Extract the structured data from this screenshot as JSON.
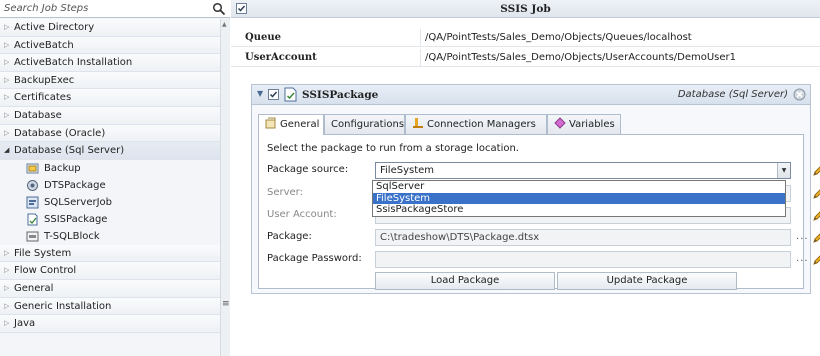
{
  "search": {
    "placeholder": "Search Job Steps",
    "icon": "magnifier-icon"
  },
  "steps": {
    "before": [
      "Active Directory",
      "ActiveBatch",
      "ActiveBatch Installation",
      "BackupExec",
      "Certificates",
      "Database",
      "Database (Oracle)"
    ],
    "open": "Database (Sql Server)",
    "children": [
      "Backup",
      "DTSPackage",
      "SQLServerJob",
      "SSISPackage",
      "T-SQLBlock"
    ],
    "after": [
      "File System",
      "Flow Control",
      "General",
      "Generic Installation",
      "Java"
    ]
  },
  "header": {
    "title": "SSIS Job"
  },
  "properties": [
    {
      "key": "Queue",
      "value": "/QA/PointTests/Sales_Demo/Objects/Queues/localhost"
    },
    {
      "key": "UserAccount",
      "value": "/QA/PointTests/Sales_Demo/Objects/UserAccounts/DemoUser1"
    }
  ],
  "package": {
    "name": "SSISPackage",
    "category": "Database (Sql Server)",
    "tabs": [
      "General",
      "Configurations",
      "Connection Managers",
      "Variables"
    ],
    "instruction": "Select the package to run from a storage location.",
    "fields": {
      "source_label": "Package source:",
      "source_value": "FileSystem",
      "server_label": "Server:",
      "account_label": "User Account:",
      "package_label": "Package:",
      "package_value": "C:\\tradeshow\\DTS\\Package.dtsx",
      "password_label": "Package Password:"
    },
    "dropdown_options": [
      "SqlServer",
      "FileSystem",
      "SsisPackageStore"
    ],
    "buttons": {
      "load": "Load Package",
      "update": "Update Package"
    },
    "ellipsis": "..."
  },
  "colors": {
    "accent": "#3a72c9",
    "header_bg": "#e0e6ed",
    "panel_bg": "#f3f5f8"
  }
}
